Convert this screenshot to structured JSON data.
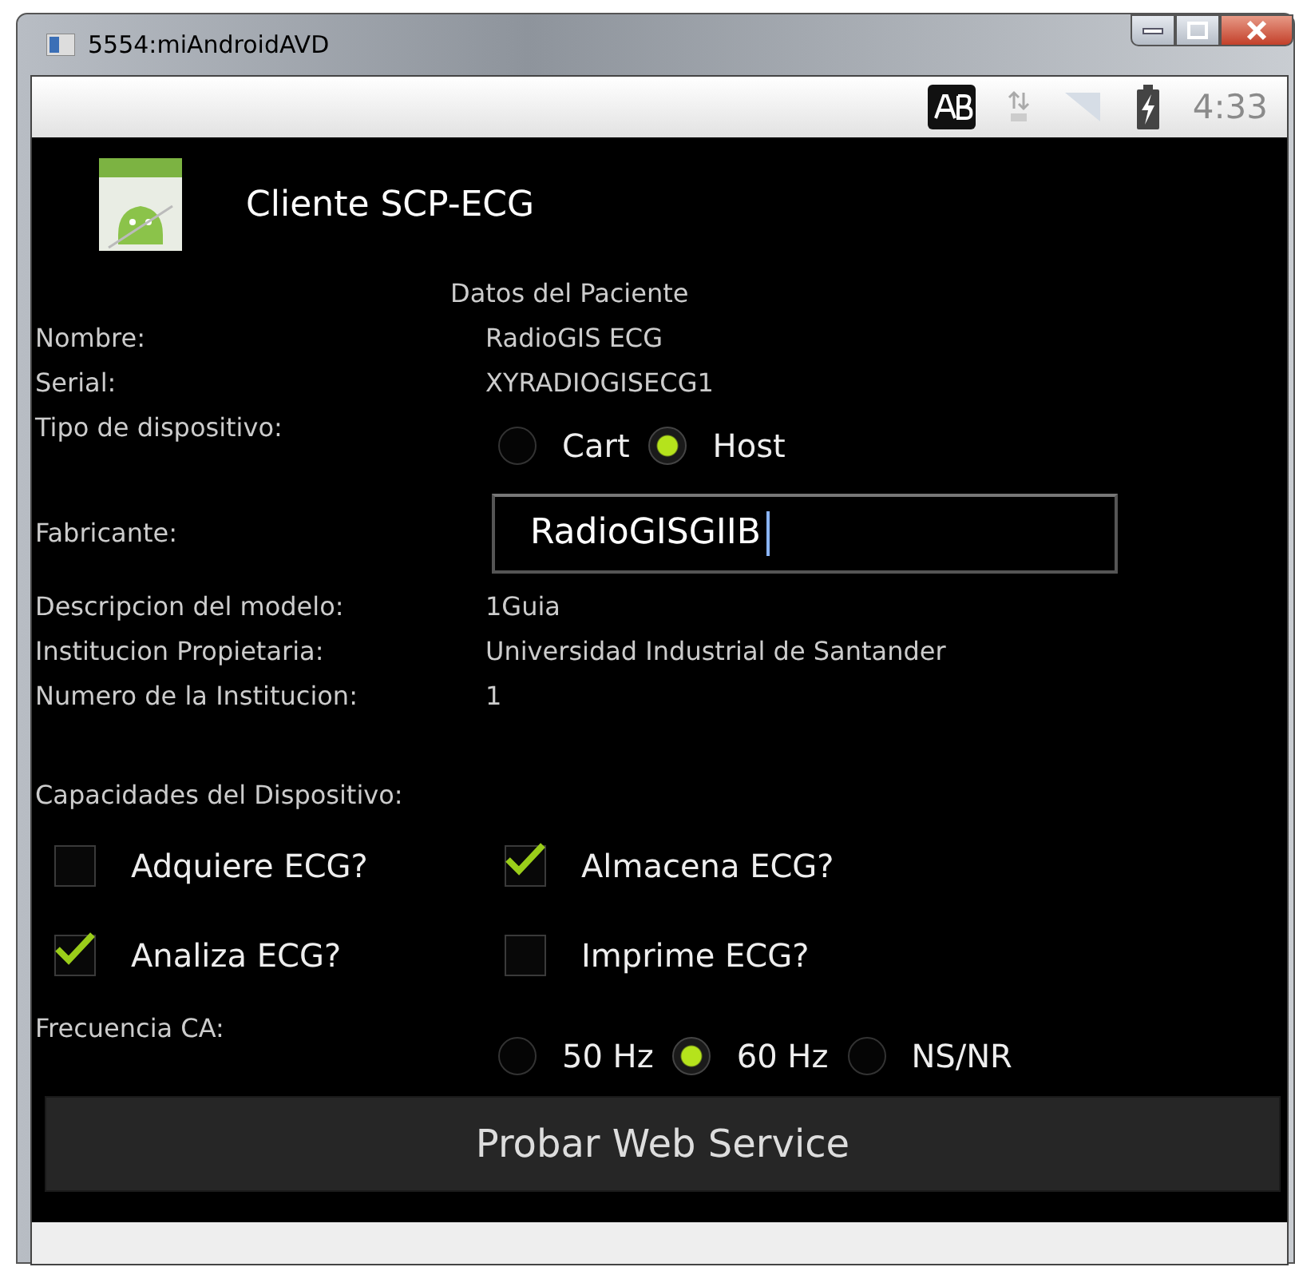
{
  "window": {
    "title": "5554:miAndroidAVD"
  },
  "status_bar": {
    "time": "4:33"
  },
  "app_title": "Cliente SCP-ECG",
  "section_title": "Datos del Paciente",
  "rows": [
    {
      "kind": "text",
      "label": "Nombre:",
      "value": "RadioGIS ECG"
    },
    {
      "kind": "text",
      "label": "Serial:",
      "value": "XYRADIOGISECG1"
    },
    {
      "kind": "radio",
      "label": "Tipo de dispositivo:",
      "options": [
        {
          "label": "Cart",
          "selected": false
        },
        {
          "label": "Host",
          "selected": true
        }
      ]
    },
    {
      "kind": "input",
      "label": "Fabricante:",
      "value": "RadioGISGIIB"
    },
    {
      "kind": "text",
      "label": "Descripcion del modelo:",
      "value": "1Guia"
    },
    {
      "kind": "text",
      "label": "Institucion Propietaria:",
      "value": "Universidad Industrial de Santander"
    },
    {
      "kind": "text",
      "label": "Numero de la Institucion:",
      "value": "1"
    }
  ],
  "capabilities": {
    "label": "Capacidades del Dispositivo:",
    "items": [
      {
        "label": "Adquiere ECG?",
        "checked": false
      },
      {
        "label": "Almacena ECG?",
        "checked": true
      },
      {
        "label": "Analiza ECG?",
        "checked": true
      },
      {
        "label": "Imprime ECG?",
        "checked": false
      }
    ]
  },
  "frequency": {
    "label": "Frecuencia CA:",
    "options": [
      {
        "label": "50 Hz",
        "selected": false
      },
      {
        "label": "60 Hz",
        "selected": true
      },
      {
        "label": "NS/NR",
        "selected": false
      }
    ]
  },
  "button": "Probar Web Service"
}
